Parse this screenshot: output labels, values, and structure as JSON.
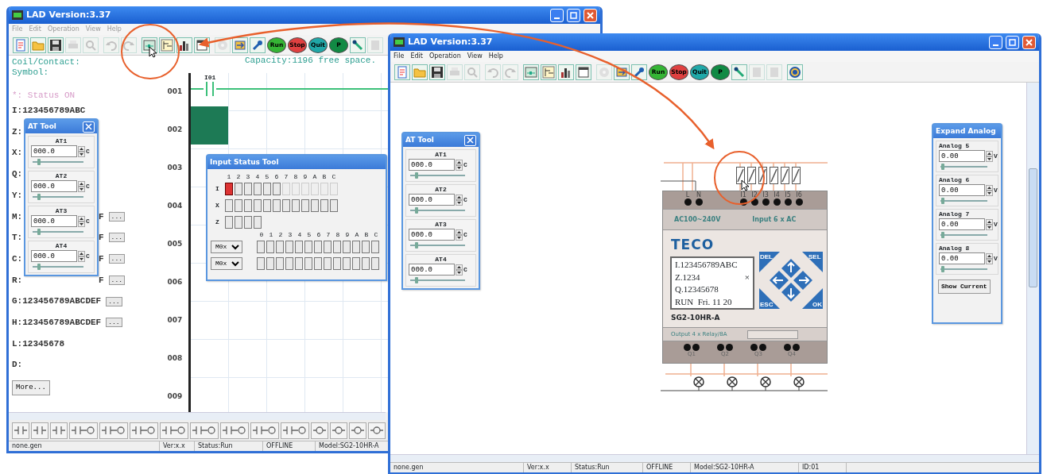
{
  "left_window": {
    "title": "LAD Version:3.37",
    "menu": [
      "File",
      "Edit",
      "Operation",
      "View",
      "Help"
    ],
    "toolbar": [
      [
        {
          "kind": "new",
          "disabled": false
        },
        {
          "kind": "open",
          "disabled": false
        },
        {
          "kind": "save",
          "disabled": false
        },
        {
          "kind": "print",
          "disabled": true
        },
        {
          "kind": "preview",
          "disabled": true
        }
      ],
      [
        {
          "kind": "undo",
          "disabled": true
        },
        {
          "kind": "redo",
          "disabled": true
        }
      ],
      [
        {
          "kind": "ladder",
          "disabled": false
        },
        {
          "kind": "fb",
          "disabled": false
        },
        {
          "kind": "chart",
          "disabled": false
        },
        {
          "kind": "window",
          "disabled": false
        }
      ],
      [
        {
          "kind": "disc",
          "disabled": true
        },
        {
          "kind": "transfer",
          "disabled": false
        },
        {
          "kind": "wrench",
          "disabled": false
        },
        {
          "kind": "run",
          "label": "Run",
          "disabled": false
        },
        {
          "kind": "stop",
          "label": "Stop",
          "disabled": false
        },
        {
          "kind": "quit",
          "label": "Quit",
          "disabled": false
        },
        {
          "kind": "pause",
          "label": "P",
          "disabled": false
        },
        {
          "kind": "link",
          "disabled": false
        },
        {
          "kind": "blank",
          "disabled": true
        }
      ]
    ],
    "panel": {
      "coil_contact": "Coil/Contact:",
      "symbol": "Symbol:",
      "status_note": "*: Status ON",
      "rows": [
        {
          "text": "I:123456789ABC"
        },
        {
          "text": "Z:"
        },
        {
          "text": "X:"
        },
        {
          "text": "Q:"
        },
        {
          "text": "Y:"
        },
        {
          "text": "M:",
          "suffix": "F",
          "more": "..."
        },
        {
          "text": "T:",
          "suffix": "F",
          "more": "..."
        },
        {
          "text": "C:",
          "suffix": "F",
          "more": "..."
        },
        {
          "text": "R:",
          "suffix": "F",
          "more": "..."
        },
        {
          "text": "G:123456789ABCDEF",
          "more": "..."
        },
        {
          "text": "H:123456789ABCDEF",
          "more": "..."
        },
        {
          "text": "L:12345678"
        },
        {
          "text": "D:"
        }
      ],
      "more_button": "More..."
    },
    "capacity": "Capacity:1196 free space.",
    "ladder": {
      "rows": [
        "001",
        "002",
        "003",
        "004",
        "005",
        "006",
        "007",
        "008",
        "009"
      ],
      "contact_label": "I01"
    },
    "at_tool": {
      "title": "AT Tool",
      "items": [
        {
          "label": "AT1",
          "value": "000.0",
          "unit": "C",
          "level": 0.12
        },
        {
          "label": "AT2",
          "value": "000.0",
          "unit": "C",
          "level": 0.12
        },
        {
          "label": "AT3",
          "value": "000.0",
          "unit": "C",
          "level": 0.12
        },
        {
          "label": "AT4",
          "value": "000.0",
          "unit": "C",
          "level": 0.12
        }
      ]
    },
    "input_status_tool": {
      "title": "Input Status Tool",
      "columns": [
        "1",
        "2",
        "3",
        "4",
        "5",
        "6",
        "7",
        "8",
        "9",
        "A",
        "B",
        "C"
      ],
      "rows": [
        {
          "label": "I",
          "cells": [
            {
              "on": true,
              "disabled": false
            },
            {
              "on": false,
              "disabled": false
            },
            {
              "on": false,
              "disabled": false
            },
            {
              "on": false,
              "disabled": false
            },
            {
              "on": false,
              "disabled": false
            },
            {
              "on": false,
              "disabled": false
            },
            {
              "on": false,
              "disabled": true
            },
            {
              "on": false,
              "disabled": true
            },
            {
              "on": false,
              "disabled": true
            },
            {
              "on": false,
              "disabled": true
            },
            {
              "on": false,
              "disabled": true
            },
            {
              "on": false,
              "disabled": true
            }
          ]
        },
        {
          "label": "X",
          "cells": [
            {
              "on": false,
              "disabled": false
            },
            {
              "on": false,
              "disabled": false
            },
            {
              "on": false,
              "disabled": false
            },
            {
              "on": false,
              "disabled": false
            },
            {
              "on": false,
              "disabled": false
            },
            {
              "on": false,
              "disabled": false
            },
            {
              "on": false,
              "disabled": false
            },
            {
              "on": false,
              "disabled": false
            },
            {
              "on": false,
              "disabled": false
            },
            {
              "on": false,
              "disabled": false
            },
            {
              "on": false,
              "disabled": false
            },
            {
              "on": false,
              "disabled": false
            }
          ]
        },
        {
          "label": "Z",
          "cells": [
            {
              "on": false,
              "disabled": false
            },
            {
              "on": false,
              "disabled": false
            },
            {
              "on": false,
              "disabled": false
            },
            {
              "on": false,
              "disabled": false
            }
          ]
        }
      ],
      "register_columns": [
        "0",
        "1",
        "2",
        "3",
        "4",
        "5",
        "6",
        "7",
        "8",
        "9",
        "A",
        "B",
        "C"
      ],
      "register_rows": [
        {
          "select": "M0x",
          "cells": [
            {
              "on": false
            },
            {
              "on": false
            },
            {
              "on": false
            },
            {
              "on": false
            },
            {
              "on": false
            },
            {
              "on": false
            },
            {
              "on": false
            },
            {
              "on": false
            },
            {
              "on": false
            },
            {
              "on": false
            },
            {
              "on": false
            },
            {
              "on": false
            },
            {
              "on": false
            }
          ]
        },
        {
          "select": "M0x",
          "cells": [
            {
              "on": false
            },
            {
              "on": false
            },
            {
              "on": false
            },
            {
              "on": false
            },
            {
              "on": false
            },
            {
              "on": false
            },
            {
              "on": false
            },
            {
              "on": false
            },
            {
              "on": false
            },
            {
              "on": false
            },
            {
              "on": false
            },
            {
              "on": false
            },
            {
              "on": false
            }
          ]
        }
      ]
    },
    "element_bar": [
      {
        "kind": "contact"
      },
      {
        "kind": "contact"
      },
      {
        "kind": "contact"
      },
      {
        "kind": "contact-coil"
      },
      {
        "kind": "contact-coil"
      },
      {
        "kind": "contact-coil"
      },
      {
        "kind": "contact-coil"
      },
      {
        "kind": "contact-coil"
      },
      {
        "kind": "contact-coil"
      },
      {
        "kind": "contact-coil"
      },
      {
        "kind": "contact-coil"
      },
      {
        "kind": "coil"
      },
      {
        "kind": "coil"
      },
      {
        "kind": "coil"
      },
      {
        "kind": "coil"
      }
    ],
    "status_bar": [
      "none.gen",
      "Ver:x.x",
      "Status:Run",
      "OFFLINE",
      "Model:SG2-10HR-A"
    ]
  },
  "right_window": {
    "title": "LAD Version:3.37",
    "menu": [
      "File",
      "Edit",
      "Operation",
      "View",
      "Help"
    ],
    "toolbar": [
      [
        {
          "kind": "new",
          "disabled": false
        },
        {
          "kind": "open",
          "disabled": false
        },
        {
          "kind": "save",
          "disabled": false
        },
        {
          "kind": "print",
          "disabled": true
        },
        {
          "kind": "preview",
          "disabled": true
        }
      ],
      [
        {
          "kind": "undo",
          "disabled": true
        },
        {
          "kind": "redo",
          "disabled": true
        }
      ],
      [
        {
          "kind": "ladder",
          "disabled": false
        },
        {
          "kind": "fb",
          "disabled": false
        },
        {
          "kind": "chart",
          "disabled": false
        },
        {
          "kind": "window",
          "disabled": false
        }
      ],
      [
        {
          "kind": "disc",
          "disabled": true
        },
        {
          "kind": "transfer",
          "disabled": false
        },
        {
          "kind": "wrench",
          "disabled": false
        },
        {
          "kind": "run",
          "label": "Run",
          "disabled": false
        },
        {
          "kind": "stop",
          "label": "Stop",
          "disabled": false
        },
        {
          "kind": "quit",
          "label": "Quit",
          "disabled": false
        },
        {
          "kind": "pause",
          "label": "P",
          "disabled": false
        },
        {
          "kind": "link",
          "disabled": false
        },
        {
          "kind": "blank",
          "disabled": true
        },
        {
          "kind": "blank",
          "disabled": true
        }
      ],
      [
        {
          "kind": "help",
          "disabled": false
        }
      ]
    ],
    "at_tool": {
      "title": "AT Tool",
      "items": [
        {
          "label": "AT1",
          "value": "000.0",
          "unit": "C",
          "level": 0.12
        },
        {
          "label": "AT2",
          "value": "000.0",
          "unit": "C",
          "level": 0.12
        },
        {
          "label": "AT3",
          "value": "000.0",
          "unit": "C",
          "level": 0.12
        },
        {
          "label": "AT4",
          "value": "000.0",
          "unit": "C",
          "level": 0.12
        }
      ]
    },
    "plc": {
      "power_terminals": [
        "L",
        "N"
      ],
      "input_terminals": [
        "I1",
        "I2",
        "I3",
        "I4",
        "I5",
        "I6"
      ],
      "power_label": "AC100~240V",
      "input_label": "Input 6 x AC",
      "brand": "TECO",
      "lcd": [
        {
          "text": "I.123456789ABC"
        },
        {
          "text": "Z.1234",
          "mark": "×"
        },
        {
          "text": "Q.12345678"
        },
        {
          "text": "RUN  Fri. 11 20"
        }
      ],
      "keys": [
        "DEL",
        "SEL",
        "ESC",
        "OK"
      ],
      "model": "SG2-10HR-A",
      "output_label": "Output 4 x Relay/8A",
      "output_terminals": [
        "Q1",
        "Q2",
        "Q3",
        "Q4"
      ]
    },
    "expand_analog": {
      "title": "Expand Analog",
      "items": [
        {
          "label": "Analog 5",
          "value": "0.00",
          "unit": "V",
          "level": 0.05
        },
        {
          "label": "Analog 6",
          "value": "0.00",
          "unit": "V",
          "level": 0.05
        },
        {
          "label": "Analog 7",
          "value": "0.00",
          "unit": "V",
          "level": 0.05
        },
        {
          "label": "Analog 8",
          "value": "0.00",
          "unit": "V",
          "level": 0.05
        }
      ],
      "button": "Show Current"
    },
    "status_bar": [
      "none.gen",
      "Ver:x.x",
      "Status:Run",
      "OFFLINE",
      "Model:SG2-10HR-A",
      "ID:01"
    ]
  }
}
